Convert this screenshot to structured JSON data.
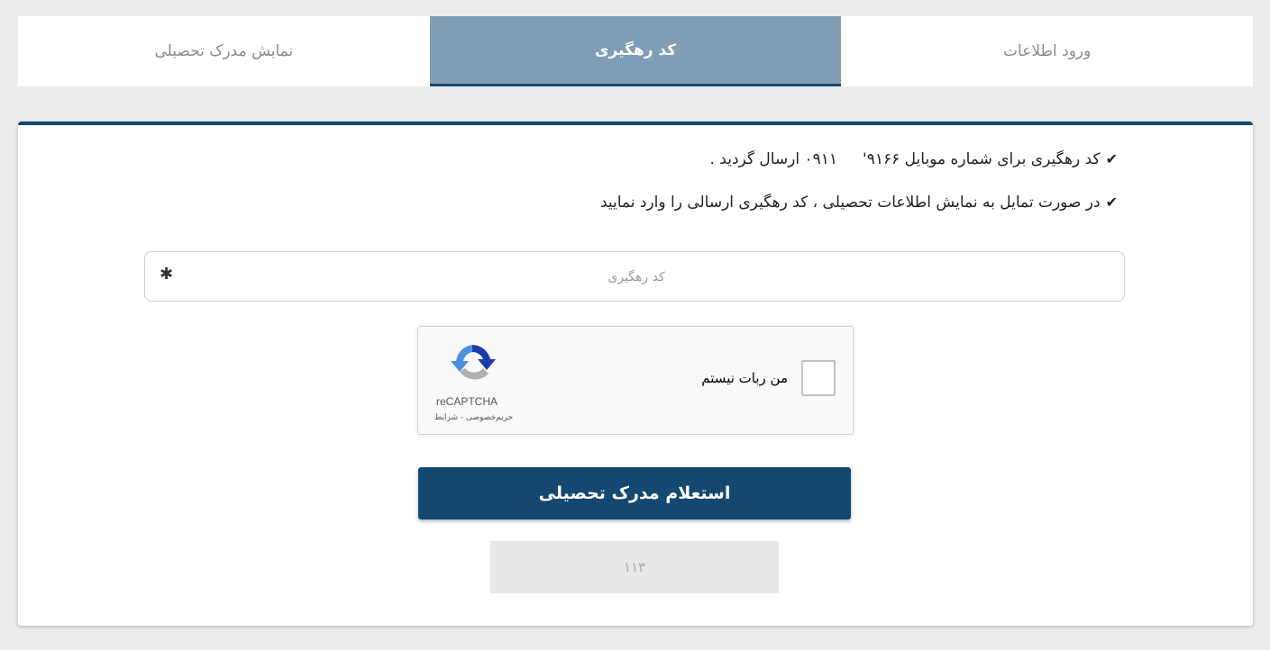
{
  "tabs": [
    {
      "label": "نمایش مدرک تحصیلی",
      "active": false
    },
    {
      "label": "کد رهگیری",
      "active": true
    },
    {
      "label": "ورود اطلاعات",
      "active": false
    }
  ],
  "notices": [
    {
      "icon": "check-icon",
      "text_before": "کد رهگیری برای شماره موبایل ۹۱۶۶'",
      "text_after": "۰۹۱۱ ارسال گردید ."
    },
    {
      "icon": "check-icon",
      "text": "در صورت تمایل به نمایش اطلاعات تحصیلی ، کد رهگیری ارسالی را وارد نمایید"
    }
  ],
  "tracking_field": {
    "placeholder": "کد رهگیری",
    "value": "",
    "required_mark": "✱"
  },
  "captcha": {
    "label": "من ربات نیستم",
    "brand": "reCAPTCHA",
    "links": "حریم‌خصوصی - شرایط",
    "checked": false
  },
  "submit_label": "استعلام مدرک تحصیلی",
  "code_display": "۱۱۳",
  "colors": {
    "primary": "#154870",
    "active_tab": "#7f9db5",
    "background": "#ececec"
  }
}
